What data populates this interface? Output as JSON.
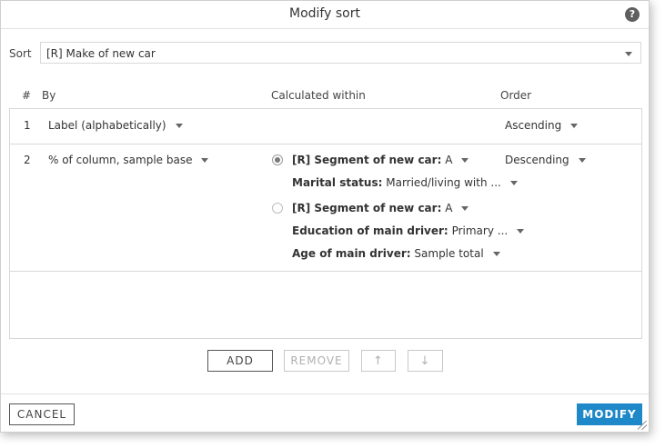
{
  "dialog": {
    "title": "Modify sort"
  },
  "sort": {
    "label": "Sort",
    "value": "[R] Make of new car"
  },
  "table": {
    "headers": {
      "num": "#",
      "by": "By",
      "within": "Calculated within",
      "order": "Order"
    },
    "rows": [
      {
        "num": "1",
        "by": "Label (alphabetically)",
        "order": "Ascending"
      },
      {
        "num": "2",
        "by": "% of column, sample base",
        "order": "Descending",
        "options": [
          {
            "selected": true,
            "lines": [
              {
                "key": "[R] Segment of new car:",
                "value": "A"
              },
              {
                "key": "Marital status:",
                "value": "Married/living with ..."
              }
            ]
          },
          {
            "selected": false,
            "lines": [
              {
                "key": "[R] Segment of new car:",
                "value": "A"
              },
              {
                "key": "Education of main driver:",
                "value": "Primary ..."
              },
              {
                "key": "Age of main driver:",
                "value": "Sample total"
              }
            ]
          }
        ]
      }
    ]
  },
  "toolbar": {
    "add": "ADD",
    "remove": "REMOVE",
    "up": "↑",
    "down": "↓"
  },
  "footer": {
    "cancel": "CANCEL",
    "modify": "MODIFY"
  },
  "colors": {
    "primary": "#1e88c8",
    "border": "#d8d8d8"
  },
  "icons": {
    "help": "?"
  }
}
